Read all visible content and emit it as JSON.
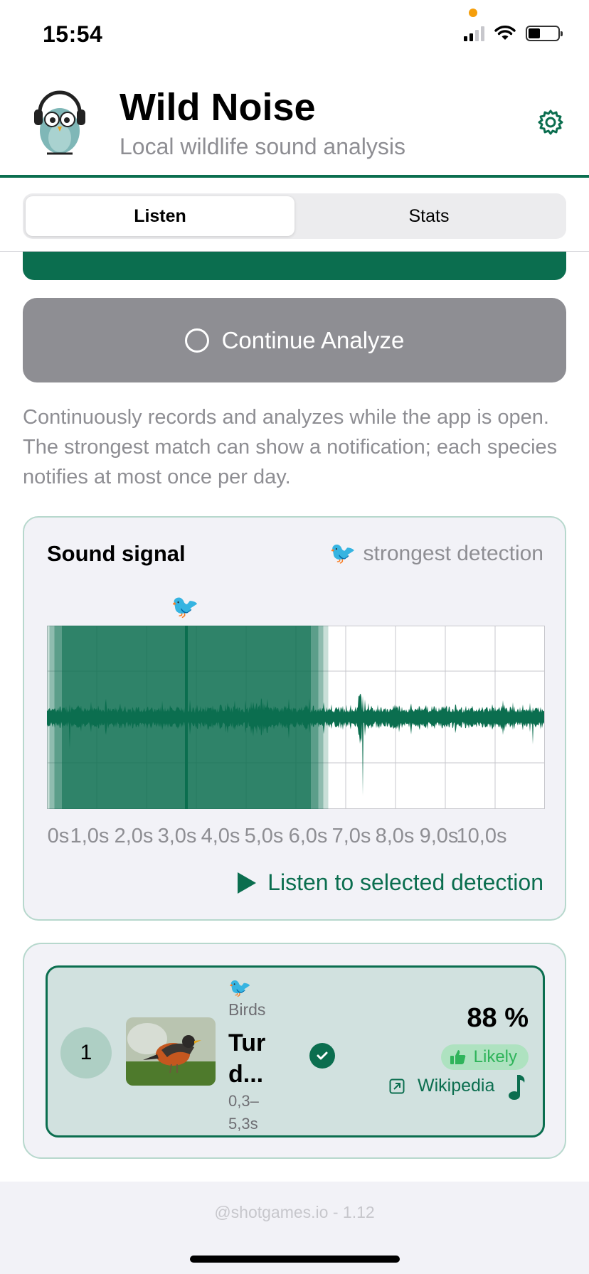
{
  "status_bar": {
    "time": "15:54"
  },
  "header": {
    "title": "Wild Noise",
    "subtitle": "Local wildlife sound analysis",
    "settings_icon": "gear-icon",
    "logo_icon": "owl-headphones-logo"
  },
  "tabs": [
    {
      "label": "Listen",
      "active": true
    },
    {
      "label": "Stats",
      "active": false
    }
  ],
  "analyze_button": {
    "label": "Continue Analyze"
  },
  "description": "Continuously records and analyzes while the app is open. The strongest match can show a notification; each species notifies at most once per day.",
  "sound_signal": {
    "title": "Sound signal",
    "strongest_label": "strongest detection",
    "emoji": "🐦",
    "x_tick_labels": [
      "0s",
      "1,0s",
      "2,0s",
      "3,0s",
      "4,0s",
      "5,0s",
      "6,0s",
      "7,0s",
      "8,0s",
      "9,0s",
      "10,0s"
    ],
    "selection_seconds": [
      0.3,
      5.3
    ],
    "marker_seconds": 2.8,
    "listen_label": "Listen to selected detection",
    "colors": {
      "waveform": "#0b6e4f",
      "selection": "#0b6e4f"
    }
  },
  "detections": [
    {
      "rank": "1",
      "emoji": "🐦",
      "category": "Birds",
      "name": "Tur d...",
      "time_range": "0,3– 5,3s",
      "confidence": "88 %",
      "likelihood": "Likely",
      "wiki_label": "Wikipedia",
      "verified": true
    }
  ],
  "footer": {
    "text": "@shotgames.io - 1.12"
  }
}
